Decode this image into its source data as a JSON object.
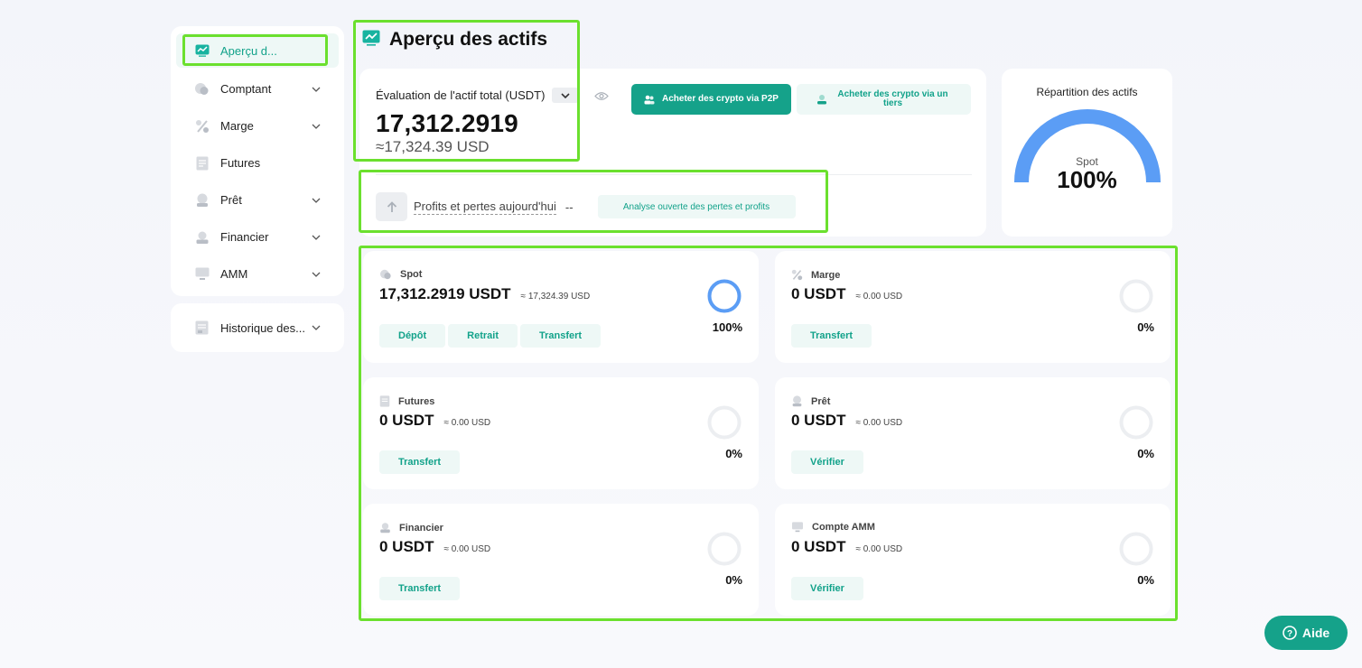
{
  "sidebar": {
    "items": [
      {
        "label": "Aperçu d...",
        "icon": "chart-trend-icon",
        "active": true,
        "chevron": false
      },
      {
        "label": "Comptant",
        "icon": "coins-icon",
        "chevron": true
      },
      {
        "label": "Marge",
        "icon": "percent-icon",
        "chevron": true
      },
      {
        "label": "Futures",
        "icon": "document-icon",
        "chevron": false
      },
      {
        "label": "Prêt",
        "icon": "loan-icon",
        "chevron": true
      },
      {
        "label": "Financier",
        "icon": "piggy-icon",
        "chevron": true
      },
      {
        "label": "AMM",
        "icon": "monitor-icon",
        "chevron": true
      }
    ],
    "history": {
      "label": "Historique des...",
      "icon": "history-icon"
    }
  },
  "header": {
    "title": "Aperçu des actifs",
    "icon": "chart-trend-icon"
  },
  "summary": {
    "eval_label": "Évaluation de l'actif total (USDT)",
    "total": "17,312.2919",
    "total_usd": "≈17,324.39 USD",
    "btn_p2p": "Acheter des crypto via P2P",
    "btn_third": "Acheter des crypto via un tiers",
    "pnl_label": "Profits et pertes aujourd'hui",
    "pnl_value": "--",
    "analyse_label": "Analyse ouverte des pertes et profits"
  },
  "distribution": {
    "title": "Répartition des actifs",
    "segment_label": "Spot",
    "value": "100%",
    "spot_fraction": 1.0,
    "color": "#5b9df5"
  },
  "accounts": [
    {
      "name": "Spot",
      "icon": "coins-icon",
      "amount": "17,312.2919 USDT",
      "approx": "≈ 17,324.39 USD",
      "pct": "100%",
      "fraction": 1.0,
      "actions": [
        "Dépôt",
        "Retrait",
        "Transfert"
      ]
    },
    {
      "name": "Marge",
      "icon": "percent-icon",
      "amount": "0 USDT",
      "approx": "≈ 0.00 USD",
      "pct": "0%",
      "fraction": 0,
      "actions": [
        "Transfert"
      ]
    },
    {
      "name": "Futures",
      "icon": "document-icon",
      "amount": "0 USDT",
      "approx": "≈ 0.00 USD",
      "pct": "0%",
      "fraction": 0,
      "actions": [
        "Transfert"
      ]
    },
    {
      "name": "Prêt",
      "icon": "loan-icon",
      "amount": "0 USDT",
      "approx": "≈ 0.00 USD",
      "pct": "0%",
      "fraction": 0,
      "actions": [
        "Vérifier"
      ]
    },
    {
      "name": "Financier",
      "icon": "piggy-icon",
      "amount": "0 USDT",
      "approx": "≈ 0.00 USD",
      "pct": "0%",
      "fraction": 0,
      "actions": [
        "Transfert"
      ]
    },
    {
      "name": "Compte AMM",
      "icon": "monitor-icon",
      "amount": "0 USDT",
      "approx": "≈ 0.00 USD",
      "pct": "0%",
      "fraction": 0,
      "actions": [
        "Vérifier"
      ]
    }
  ],
  "help": {
    "label": "Aide"
  },
  "colors": {
    "accent": "#15a28a",
    "accent_light": "#eef8f6",
    "ring_blue": "#5b9df5",
    "highlight": "#6be02e"
  }
}
